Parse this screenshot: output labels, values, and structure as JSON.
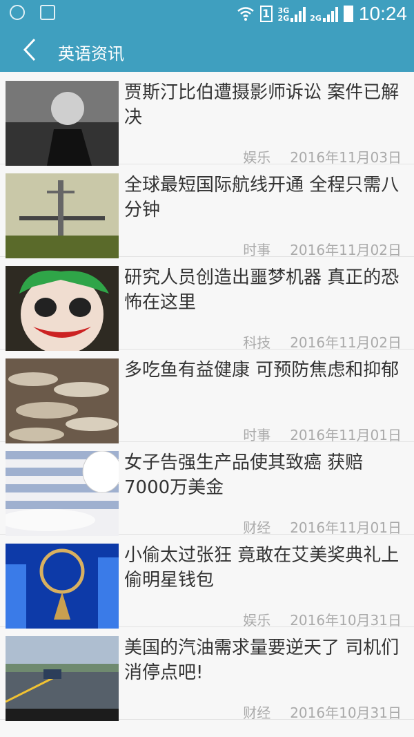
{
  "status_bar": {
    "time": "10:24",
    "sim_label": "1",
    "network_top": "3G",
    "network_bottom": "2G",
    "network_2": "2G",
    "icons": [
      "emoji-icon",
      "image-icon",
      "wifi-icon",
      "sim-icon",
      "signal-icon",
      "battery-icon"
    ]
  },
  "app_bar": {
    "title": "英语资讯",
    "back_icon": "chevron-left-icon"
  },
  "articles": [
    {
      "title": "贾斯汀比伯遭摄影师诉讼 案件已解决",
      "category": "娱乐",
      "date": "2016年11月03日"
    },
    {
      "title": "全球最短国际航线开通 全程只需八分钟",
      "category": "时事",
      "date": "2016年11月02日"
    },
    {
      "title": "研究人员创造出噩梦机器 真正的恐怖在这里",
      "category": "科技",
      "date": "2016年11月02日"
    },
    {
      "title": "多吃鱼有益健康 可预防焦虑和抑郁",
      "category": "时事",
      "date": "2016年11月01日"
    },
    {
      "title": "女子告强生产品使其致癌 获赔7000万美金",
      "category": "财经",
      "date": "2016年11月01日"
    },
    {
      "title": "小偷太过张狂 竟敢在艾美奖典礼上偷明星钱包",
      "category": "娱乐",
      "date": "2016年10月31日"
    },
    {
      "title": "美国的汽油需求量要逆天了 司机们消停点吧!",
      "category": "财经",
      "date": "2016年10月31日"
    }
  ]
}
